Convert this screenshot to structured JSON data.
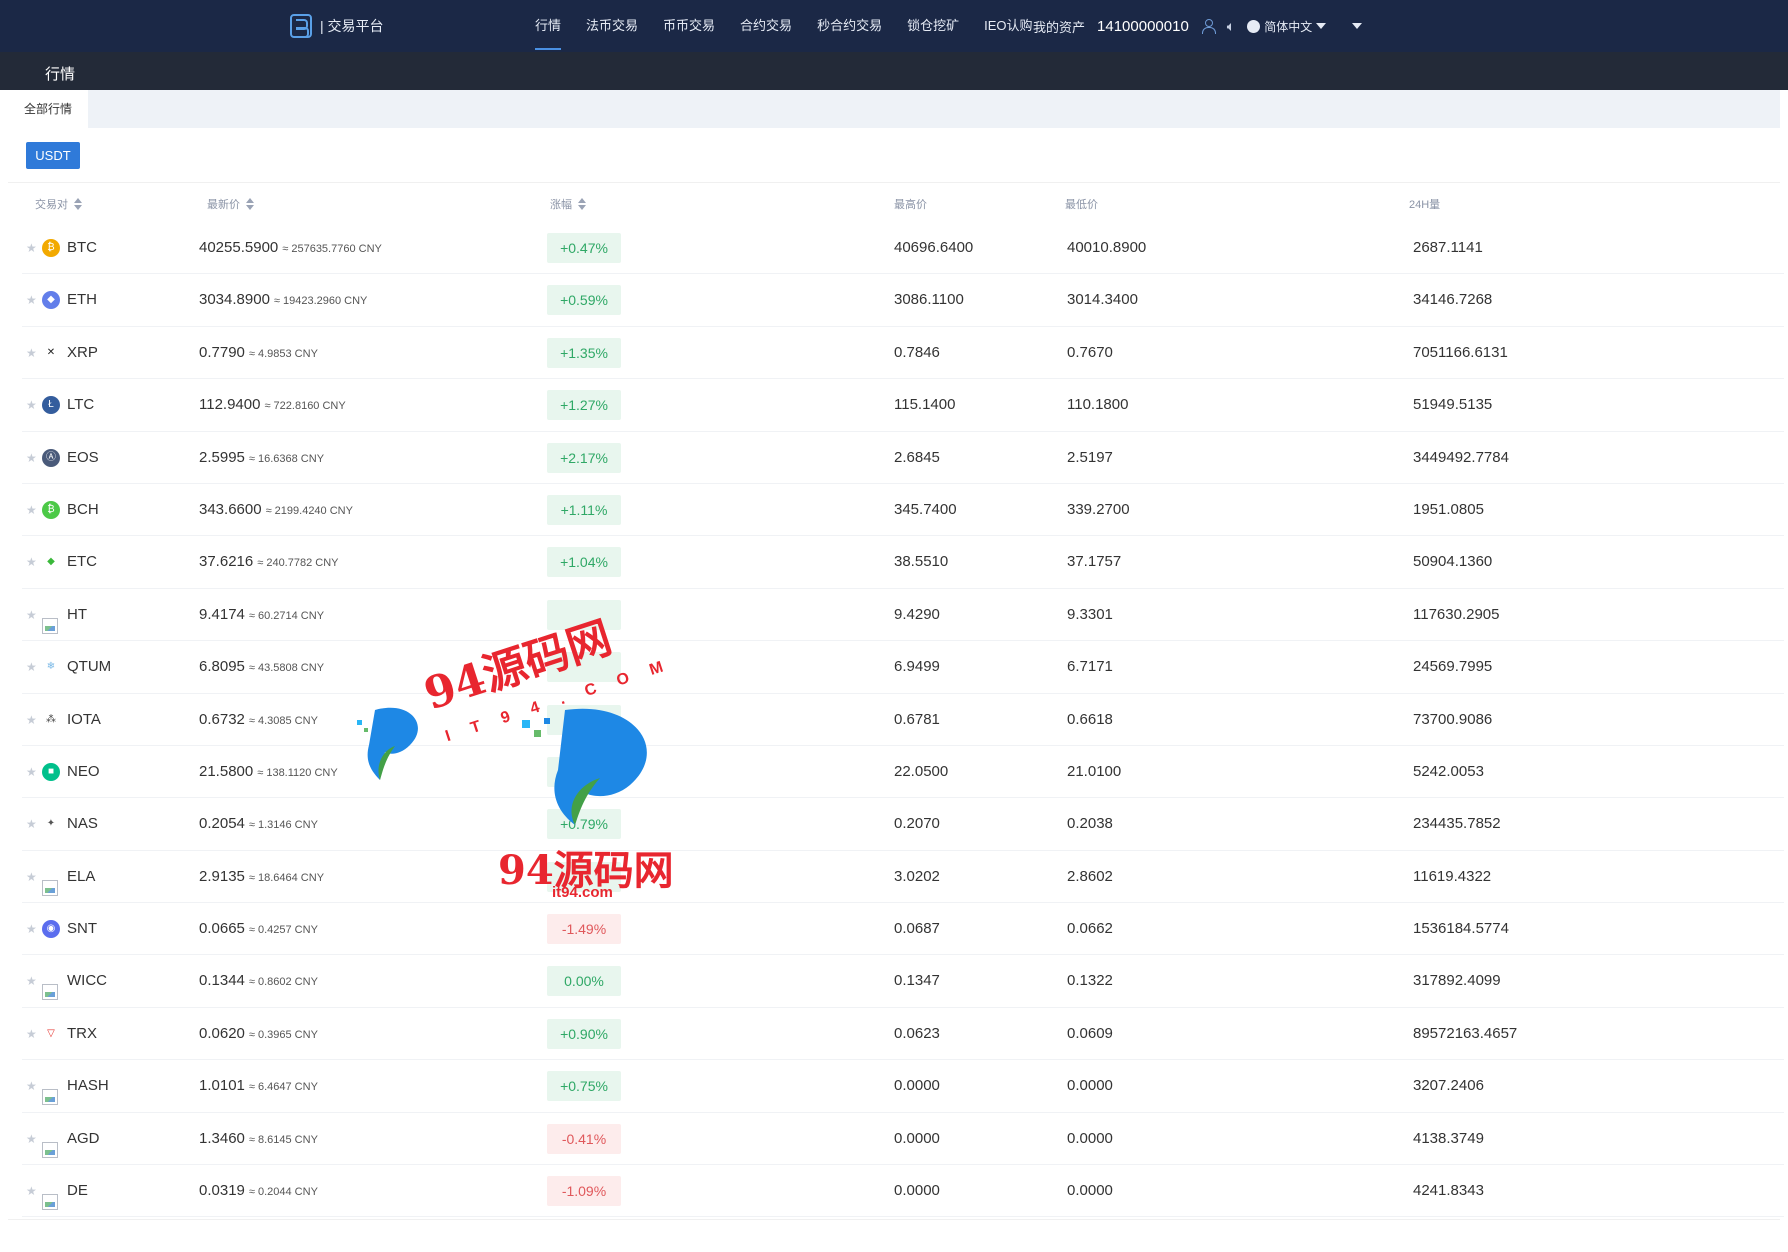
{
  "header": {
    "logo_text": "| 交易平台",
    "nav": [
      "行情",
      "法币交易",
      "币币交易",
      "合约交易",
      "秒合约交易",
      "锁仓挖矿",
      "IEO认购"
    ],
    "assets_label": "我的资产",
    "account": "14100000010",
    "language": "简体中文"
  },
  "subbar": {
    "title": "行情"
  },
  "tabs": {
    "all_markets": "全部行情"
  },
  "quote_button": "USDT",
  "columns": {
    "pair": "交易对",
    "last_price": "最新价",
    "change": "涨幅",
    "high": "最高价",
    "low": "最低价",
    "volume": "24H量"
  },
  "colors": {
    "up_text": "#2fa866",
    "down_text": "#e0585b",
    "topbar": "#1b2846",
    "accent": "#2f7ad9"
  },
  "rows": [
    {
      "coin": "BTC",
      "icon": "btc-icon",
      "price": "40255.5900",
      "cny": "≈ 257635.7760 CNY",
      "change": "+0.47%",
      "dir": "up",
      "high": "40696.6400",
      "low": "40010.8900",
      "volume": "2687.1141"
    },
    {
      "coin": "ETH",
      "icon": "eth-icon",
      "price": "3034.8900",
      "cny": "≈ 19423.2960 CNY",
      "change": "+0.59%",
      "dir": "up",
      "high": "3086.1100",
      "low": "3014.3400",
      "volume": "34146.7268"
    },
    {
      "coin": "XRP",
      "icon": "xrp-icon",
      "price": "0.7790",
      "cny": "≈ 4.9853 CNY",
      "change": "+1.35%",
      "dir": "up",
      "high": "0.7846",
      "low": "0.7670",
      "volume": "7051166.6131"
    },
    {
      "coin": "LTC",
      "icon": "ltc-icon",
      "price": "112.9400",
      "cny": "≈ 722.8160 CNY",
      "change": "+1.27%",
      "dir": "up",
      "high": "115.1400",
      "low": "110.1800",
      "volume": "51949.5135"
    },
    {
      "coin": "EOS",
      "icon": "eos-icon",
      "price": "2.5995",
      "cny": "≈ 16.6368 CNY",
      "change": "+2.17%",
      "dir": "up",
      "high": "2.6845",
      "low": "2.5197",
      "volume": "3449492.7784"
    },
    {
      "coin": "BCH",
      "icon": "bch-icon",
      "price": "343.6600",
      "cny": "≈ 2199.4240 CNY",
      "change": "+1.11%",
      "dir": "up",
      "high": "345.7400",
      "low": "339.2700",
      "volume": "1951.0805"
    },
    {
      "coin": "ETC",
      "icon": "etc-icon",
      "price": "37.6216",
      "cny": "≈ 240.7782 CNY",
      "change": "+1.04%",
      "dir": "up",
      "high": "38.5510",
      "low": "37.1757",
      "volume": "50904.1360"
    },
    {
      "coin": "HT",
      "icon": "broken-image-icon",
      "price": "9.4174",
      "cny": "≈ 60.2714 CNY",
      "change": "",
      "dir": "up",
      "high": "9.4290",
      "low": "9.3301",
      "volume": "117630.2905"
    },
    {
      "coin": "QTUM",
      "icon": "qtum-icon",
      "price": "6.8095",
      "cny": "≈ 43.5808 CNY",
      "change": "",
      "dir": "up",
      "high": "6.9499",
      "low": "6.7171",
      "volume": "24569.7995"
    },
    {
      "coin": "IOTA",
      "icon": "iota-icon",
      "price": "0.6732",
      "cny": "≈ 4.3085 CNY",
      "change": "",
      "dir": "up",
      "high": "0.6781",
      "low": "0.6618",
      "volume": "73700.9086"
    },
    {
      "coin": "NEO",
      "icon": "neo-icon",
      "price": "21.5800",
      "cny": "≈ 138.1120 CNY",
      "change": "",
      "dir": "up",
      "high": "22.0500",
      "low": "21.0100",
      "volume": "5242.0053"
    },
    {
      "coin": "NAS",
      "icon": "nas-icon",
      "price": "0.2054",
      "cny": "≈ 1.3146 CNY",
      "change": "+0.79%",
      "dir": "up",
      "high": "0.2070",
      "low": "0.2038",
      "volume": "234435.7852"
    },
    {
      "coin": "ELA",
      "icon": "broken-image-icon",
      "price": "2.9135",
      "cny": "≈ 18.6464 CNY",
      "change": "",
      "dir": "up",
      "high": "3.0202",
      "low": "2.8602",
      "volume": "11619.4322"
    },
    {
      "coin": "SNT",
      "icon": "snt-icon",
      "price": "0.0665",
      "cny": "≈ 0.4257 CNY",
      "change": "-1.49%",
      "dir": "down",
      "high": "0.0687",
      "low": "0.0662",
      "volume": "1536184.5774"
    },
    {
      "coin": "WICC",
      "icon": "broken-image-icon",
      "price": "0.1344",
      "cny": "≈ 0.8602 CNY",
      "change": "0.00%",
      "dir": "up",
      "high": "0.1347",
      "low": "0.1322",
      "volume": "317892.4099"
    },
    {
      "coin": "TRX",
      "icon": "trx-icon",
      "price": "0.0620",
      "cny": "≈ 0.3965 CNY",
      "change": "+0.90%",
      "dir": "up",
      "high": "0.0623",
      "low": "0.0609",
      "volume": "89572163.4657"
    },
    {
      "coin": "HASH",
      "icon": "broken-image-icon",
      "price": "1.0101",
      "cny": "≈ 6.4647 CNY",
      "change": "+0.75%",
      "dir": "up",
      "high": "0.0000",
      "low": "0.0000",
      "volume": "3207.2406"
    },
    {
      "coin": "AGD",
      "icon": "broken-image-icon",
      "price": "1.3460",
      "cny": "≈ 8.6145 CNY",
      "change": "-0.41%",
      "dir": "down",
      "high": "0.0000",
      "low": "0.0000",
      "volume": "4138.3749"
    },
    {
      "coin": "DE",
      "icon": "broken-image-icon",
      "price": "0.0319",
      "cny": "≈ 0.2044 CNY",
      "change": "-1.09%",
      "dir": "down",
      "high": "0.0000",
      "low": "0.0000",
      "volume": "4241.8343"
    }
  ],
  "watermark": {
    "line1": "94源码网",
    "line1_sub": "IT94.COM",
    "line2": "94源码网",
    "line2_sub": "it94.com"
  }
}
